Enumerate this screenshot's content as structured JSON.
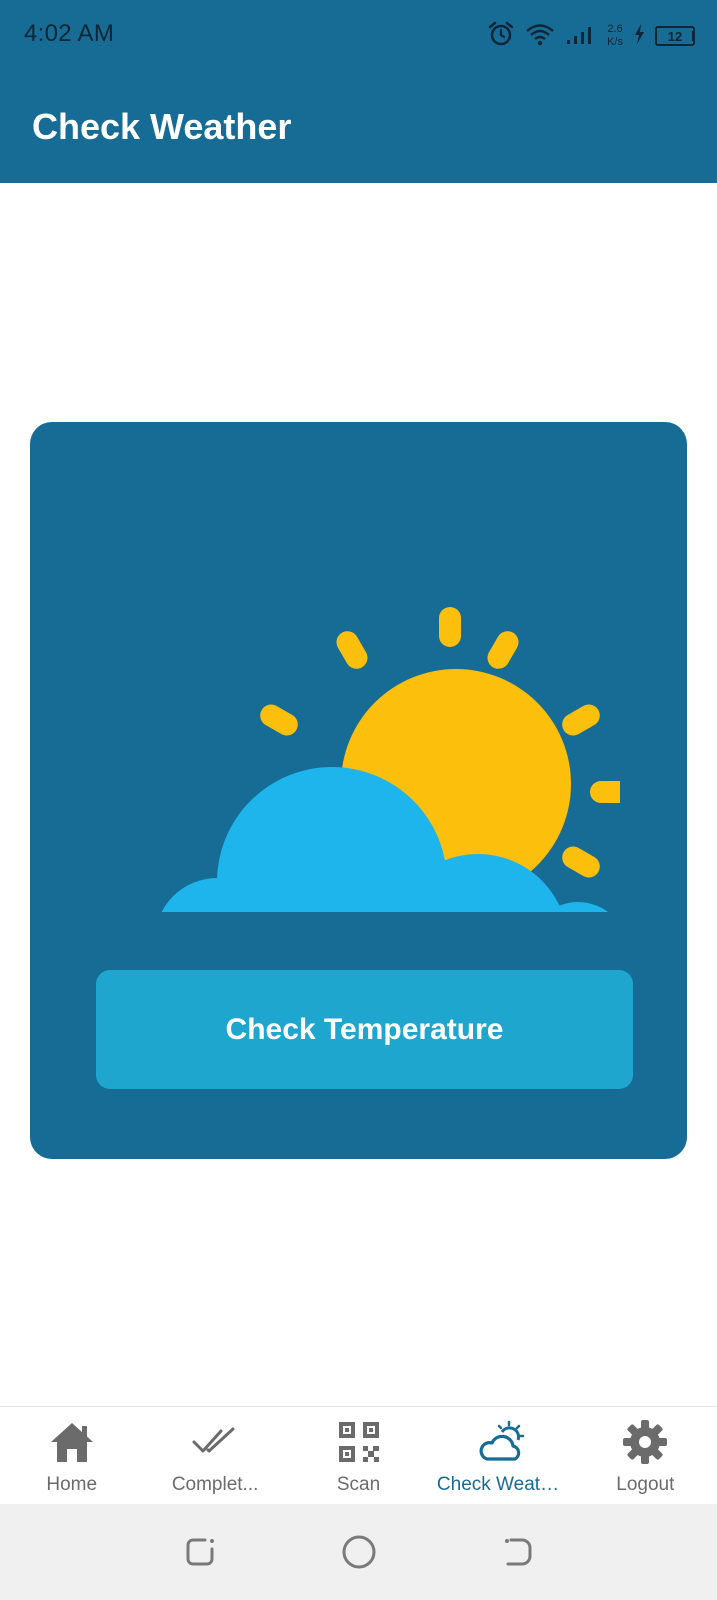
{
  "status_bar": {
    "time": "4:02 AM",
    "net_speed_value": "2.6",
    "net_speed_unit": "K/s",
    "battery_level": "12",
    "icons": [
      "alarm-icon",
      "wifi-icon",
      "signal-icon",
      "charging-icon",
      "battery-icon"
    ]
  },
  "app_bar": {
    "title": "Check Weather"
  },
  "weather_card": {
    "illustration": "sun-behind-cloud-icon",
    "button_label": "Check Temperature"
  },
  "bottom_nav": {
    "items": [
      {
        "label": "Home",
        "icon": "home-icon",
        "active": false
      },
      {
        "label": "Complet...",
        "icon": "double-check-icon",
        "active": false
      },
      {
        "label": "Scan",
        "icon": "qr-code-icon",
        "active": false
      },
      {
        "label": "Check Weather",
        "icon": "weather-icon",
        "active": true
      },
      {
        "label": "Logout",
        "icon": "gear-icon",
        "active": false
      }
    ]
  },
  "system_nav": {
    "icons": [
      "recents-icon",
      "home-circle-icon",
      "back-icon"
    ]
  },
  "colors": {
    "primary": "#176c95",
    "button": "#1ea6cf",
    "sun": "#fbbf0c",
    "cloud": "#1eb4ec",
    "inactive_nav": "#6b6b6b"
  }
}
